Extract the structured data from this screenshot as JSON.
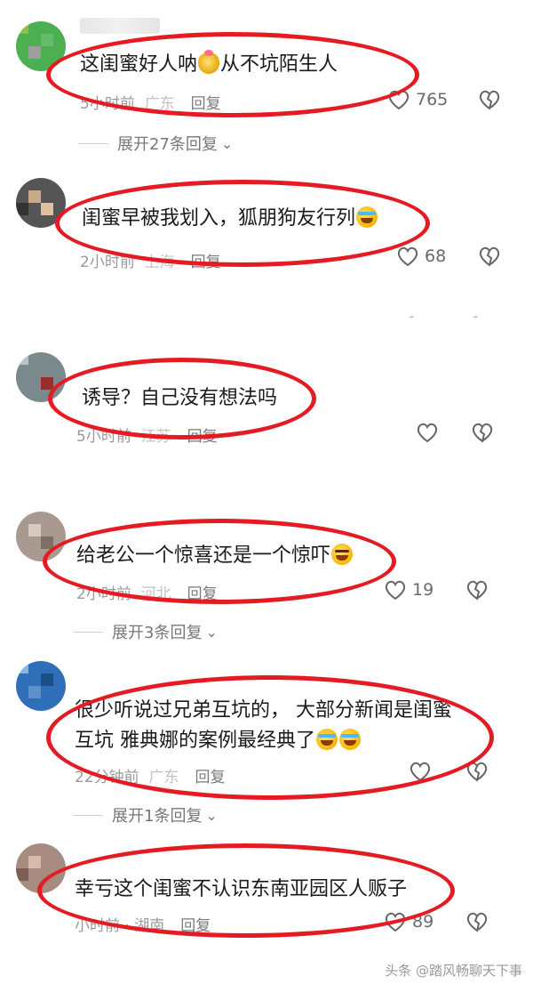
{
  "comments": [
    {
      "text": "这闺蜜好人呐",
      "emoji_name": "money-bag-emoji",
      "text_after": "从不坑陌生人",
      "time": "5小时前",
      "location": "广东",
      "reply": "回复",
      "likes": "765",
      "expand": "展开27条回复"
    },
    {
      "text": "闺蜜早被我划入，狐朋狗友行列",
      "emoji_name": "crying-emoji",
      "time": "2小时前",
      "location": "上海",
      "reply": "回复",
      "likes": "68"
    },
    {
      "text": "诱导？自己没有想法吗",
      "time": "5小时前",
      "location": "江苏",
      "reply": "回复",
      "likes": ""
    },
    {
      "text": "给老公一个惊喜还是一个惊吓",
      "emoji_name": "laughing-emoji",
      "time": "2小时前",
      "location": "河北",
      "reply": "回复",
      "likes": "19",
      "expand": "展开3条回复"
    },
    {
      "text_line1": "很少听说过兄弟互坑的， 大部分新闻是闺蜜",
      "text_line2": "互坑 雅典娜的案例最经典了",
      "emoji_name": "crying-emoji",
      "time": "22分钟前",
      "location": "广东",
      "reply": "回复",
      "likes": "",
      "expand": "展开1条回复"
    },
    {
      "text": "幸亏这个闺蜜不认识东南亚园区人贩子",
      "time": "小时前",
      "location": "湖南",
      "separator": "·",
      "reply": "回复",
      "likes": "89"
    }
  ],
  "watermark": "头条 @踏风畅聊天下事",
  "colors": {
    "highlight": "#e51b23",
    "meta": "#9a9a9a",
    "text": "#1a1a1a"
  }
}
